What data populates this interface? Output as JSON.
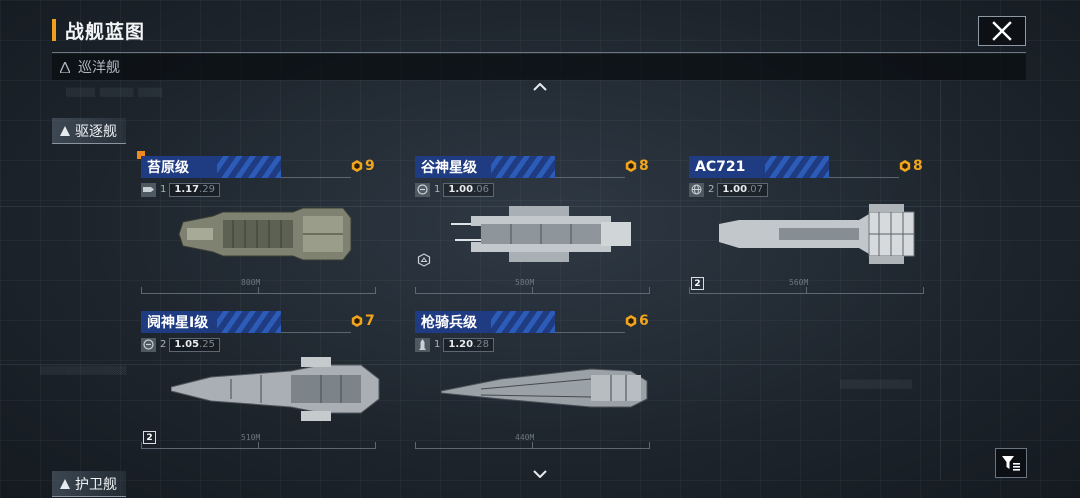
{
  "header": {
    "title": "战舰蓝图"
  },
  "categories": {
    "cruiser": "巡洋舰",
    "destroyer": "驱逐舰",
    "frigate": "护卫舰"
  },
  "ships": [
    {
      "name": "苔原级",
      "cost": "9",
      "tier": "1",
      "stat_main": "1.17",
      "stat_dec": ".29",
      "length": "800M",
      "badge": ""
    },
    {
      "name": "谷神星级",
      "cost": "8",
      "tier": "1",
      "stat_main": "1.00",
      "stat_dec": ".06",
      "length": "580M",
      "badge": "hex"
    },
    {
      "name": "AC721",
      "cost": "8",
      "tier": "2",
      "stat_main": "1.00",
      "stat_dec": ".07",
      "length": "560M",
      "badge": "2"
    },
    {
      "name": "阋神星I级",
      "cost": "7",
      "tier": "2",
      "stat_main": "1.05",
      "stat_dec": ".25",
      "length": "510M",
      "badge": "2"
    },
    {
      "name": "枪骑兵级",
      "cost": "6",
      "tier": "1",
      "stat_main": "1.20",
      "stat_dec": ".28",
      "length": "440M",
      "badge": ""
    }
  ],
  "colors": {
    "accent": "#f0a020",
    "cost": "#f0a51c",
    "card_head": "#1f3c82"
  }
}
